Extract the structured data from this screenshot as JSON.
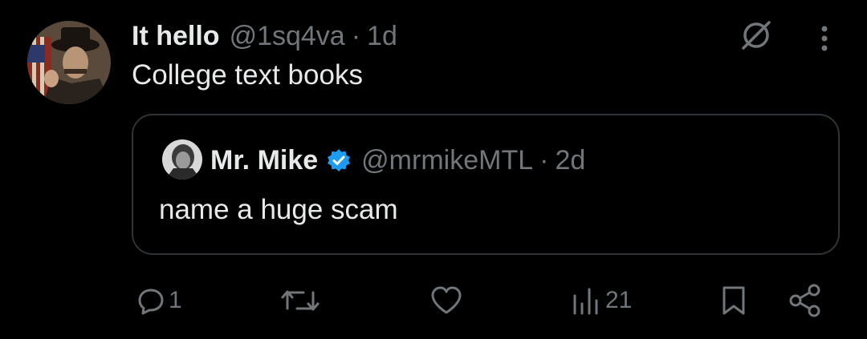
{
  "tweet": {
    "author_name": "It hello",
    "author_handle": "@1sq4va",
    "separator": "·",
    "time": "1d",
    "text": "College text books"
  },
  "quote": {
    "author_name": "Mr. Mike",
    "author_handle": "@mrmikeMTL",
    "separator": "·",
    "time": "2d",
    "text": "name a huge scam"
  },
  "actions": {
    "reply_count": "1",
    "views_count": "21"
  },
  "icons": {
    "grok": "grok-icon",
    "more": "more-vertical-icon",
    "verified": "verified-badge-icon",
    "reply": "reply-icon",
    "retweet": "retweet-icon",
    "like": "heart-icon",
    "views": "views-icon",
    "bookmark": "bookmark-icon",
    "share": "share-icon"
  },
  "colors": {
    "background": "#000000",
    "text_primary": "#e7e9ea",
    "text_secondary": "#71767b",
    "border": "#2f3336",
    "verified_blue": "#1d9bf0"
  }
}
